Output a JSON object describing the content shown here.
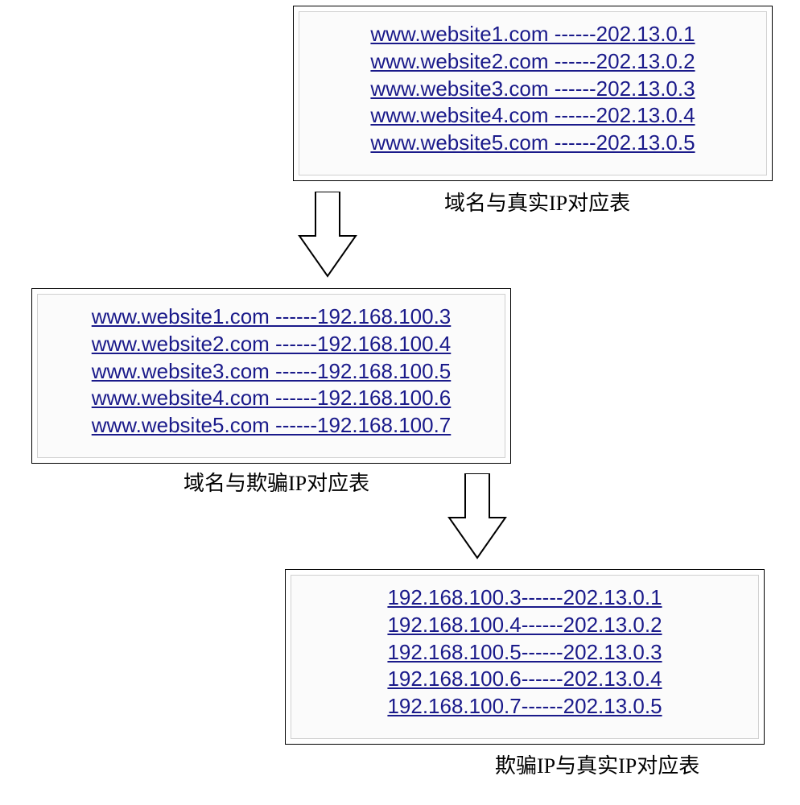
{
  "box1": {
    "caption": "域名与真实IP对应表",
    "rows": [
      {
        "domain": "www.website1.com",
        "sep": " ------",
        "ip": "202.13.0.1"
      },
      {
        "domain": "www.website2.com",
        "sep": " ------",
        "ip": "202.13.0.2"
      },
      {
        "domain": "www.website3.com",
        "sep": " ------",
        "ip": "202.13.0.3"
      },
      {
        "domain": "www.website4.com",
        "sep": " ------",
        "ip": "202.13.0.4"
      },
      {
        "domain": "www.website5.com",
        "sep": " ------",
        "ip": "202.13.0.5"
      }
    ]
  },
  "box2": {
    "caption": "域名与欺骗IP对应表",
    "rows": [
      {
        "domain": "www.website1.com",
        "sep": " ------",
        "ip": "192.168.100.3"
      },
      {
        "domain": "www.website2.com",
        "sep": " ------",
        "ip": "192.168.100.4"
      },
      {
        "domain": "www.website3.com",
        "sep": " ------",
        "ip": "192.168.100.5"
      },
      {
        "domain": "www.website4.com",
        "sep": " ------",
        "ip": "192.168.100.6"
      },
      {
        "domain": "www.website5.com",
        "sep": " ------",
        "ip": "192.168.100.7"
      }
    ]
  },
  "box3": {
    "caption": "欺骗IP与真实IP对应表",
    "rows": [
      {
        "domain": "192.168.100.3",
        "sep": "------",
        "ip": "202.13.0.1"
      },
      {
        "domain": "192.168.100.4",
        "sep": "------",
        "ip": "202.13.0.2"
      },
      {
        "domain": "192.168.100.5",
        "sep": "------",
        "ip": "202.13.0.3"
      },
      {
        "domain": "192.168.100.6",
        "sep": "------",
        "ip": "202.13.0.4"
      },
      {
        "domain": "192.168.100.7",
        "sep": "------",
        "ip": "202.13.0.5"
      }
    ]
  }
}
